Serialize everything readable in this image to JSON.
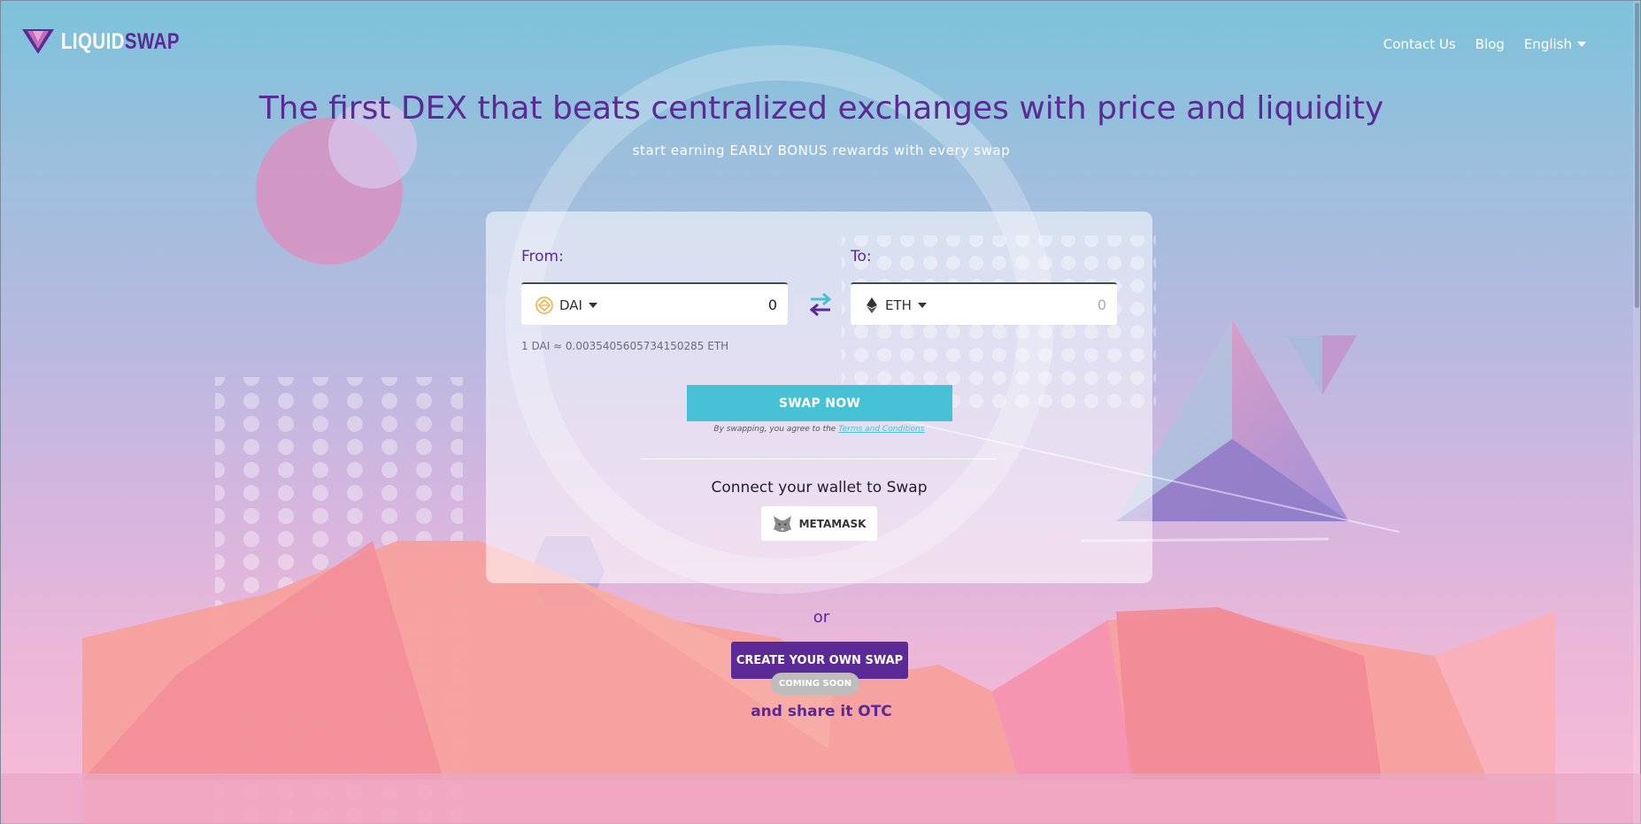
{
  "brand": {
    "name_part1": "LIQUID",
    "name_part2": "SWAP",
    "colors": {
      "purple": "#5b2a96",
      "cyan": "#47c1d6",
      "white": "#ffffff"
    }
  },
  "nav": {
    "items": [
      {
        "label": "Contact Us"
      },
      {
        "label": "Blog"
      }
    ],
    "language": "English"
  },
  "hero": {
    "title": "The first DEX that beats centralized exchanges with price and liquidity",
    "subtitle": "start earning EARLY BONUS rewards with every swap"
  },
  "swap": {
    "from_label": "From:",
    "to_label": "To:",
    "from_token": {
      "symbol": "DAI",
      "icon": "dai-coin-icon",
      "amount": "0"
    },
    "to_token": {
      "symbol": "ETH",
      "icon": "eth-coin-icon",
      "placeholder": "0"
    },
    "rate": "1 DAI ≈ 0.0035405605734150285 ETH",
    "swap_button": "SWAP NOW",
    "terms_prefix": "By swapping, you agree to the ",
    "terms_link": "Terms and Conditions",
    "connect_title": "Connect your wallet to Swap",
    "wallet_button": "METAMASK"
  },
  "otc": {
    "or_text": "or",
    "create_button": "CREATE YOUR OWN SWAP",
    "badge": "COMING SOON",
    "share_text": "and share it OTC"
  }
}
